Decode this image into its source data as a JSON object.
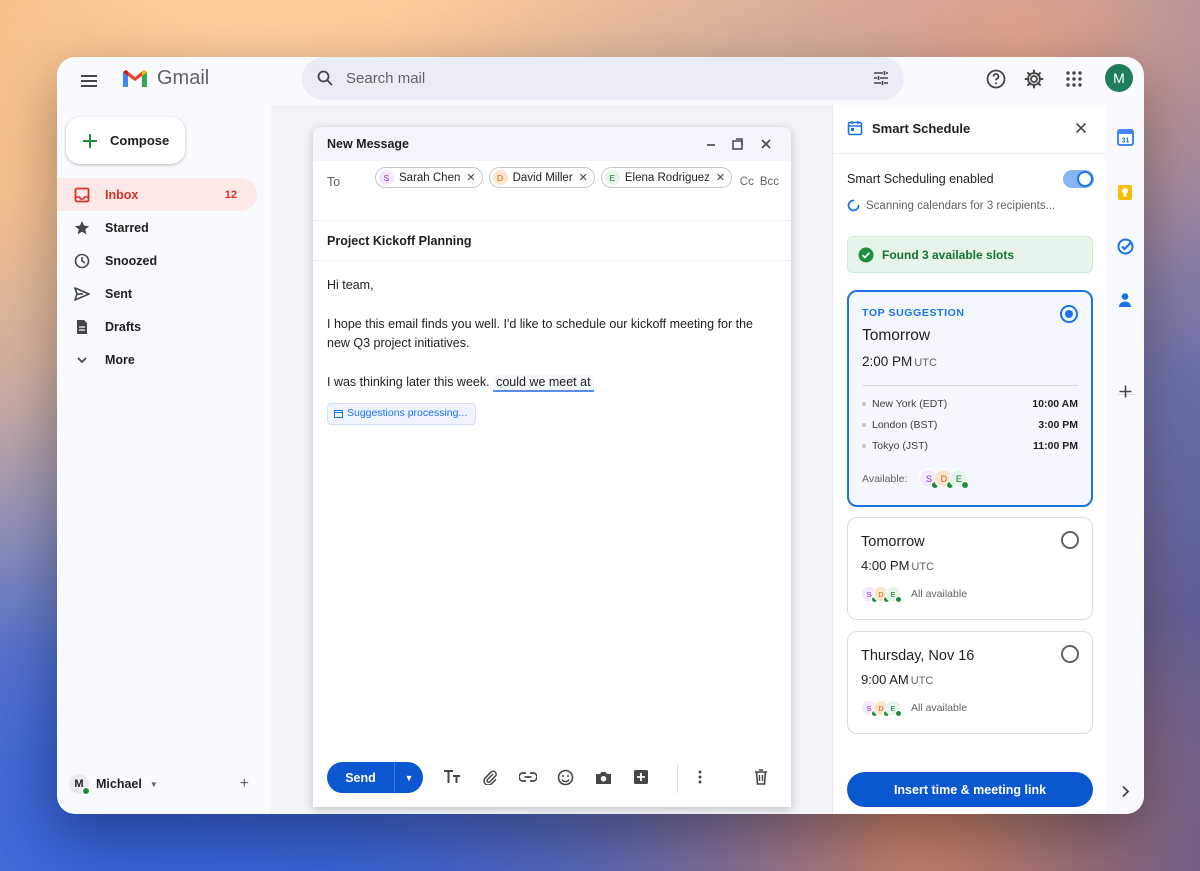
{
  "app": {
    "name": "Gmail"
  },
  "search": {
    "placeholder": "Search mail"
  },
  "account": {
    "initial": "M",
    "name": "Michael"
  },
  "nav": {
    "compose_label": "Compose",
    "items": [
      {
        "label": "Inbox",
        "count": "12",
        "icon": "inbox-icon"
      },
      {
        "label": "Starred",
        "count": "",
        "icon": "star-icon"
      },
      {
        "label": "Snoozed",
        "count": "",
        "icon": "clock-icon"
      },
      {
        "label": "Sent",
        "count": "",
        "icon": "send-icon"
      },
      {
        "label": "Drafts",
        "count": "",
        "icon": "draft-icon"
      },
      {
        "label": "More",
        "count": "",
        "icon": "chevron-down-icon"
      }
    ]
  },
  "compose": {
    "title": "New Message",
    "to_label": "To",
    "recipients": [
      {
        "initial": "S",
        "name": "Sarah Chen"
      },
      {
        "initial": "D",
        "name": "David Miller"
      },
      {
        "initial": "E",
        "name": "Elena Rodriguez"
      }
    ],
    "cc_label": "Cc",
    "bcc_label": "Bcc",
    "subject": "Project Kickoff Planning",
    "body": {
      "greeting": "Hi team,",
      "paragraph1": "I hope this email finds you well. I'd like to schedule our kickoff meeting for the new Q3 project initiatives.",
      "line3_prefix": "I was thinking later this week.",
      "line3_highlight": "could we meet at"
    },
    "processing_label": "Suggestions processing...",
    "send_label": "Send"
  },
  "panel": {
    "title": "Smart Schedule",
    "toggle_label": "Smart Scheduling enabled",
    "toggle_on": true,
    "scanning_text": "Scanning calendars for 3 recipients...",
    "found_text": "Found 3 available slots",
    "top_label": "TOP SUGGESTION",
    "suggestions": [
      {
        "day": "Tomorrow",
        "time": "2:00 PM",
        "tz": "UTC",
        "selected": true,
        "timezones": [
          {
            "city": "New York (EDT)",
            "time": "10:00 AM"
          },
          {
            "city": "London (BST)",
            "time": "3:00 PM"
          },
          {
            "city": "Tokyo (JST)",
            "time": "11:00 PM"
          }
        ],
        "available_label": "Available:"
      },
      {
        "day": "Tomorrow",
        "time": "4:00 PM",
        "tz": "UTC",
        "selected": false,
        "status": "All available"
      },
      {
        "day": "Thursday, Nov 16",
        "time": "9:00 AM",
        "tz": "UTC",
        "selected": false,
        "status": "All available"
      }
    ],
    "insert_label": "Insert time & meeting link"
  },
  "colors": {
    "primary": "#0b57d0",
    "accent": "#1a73e8",
    "inbox_active": "#d93025",
    "success": "#137333"
  }
}
